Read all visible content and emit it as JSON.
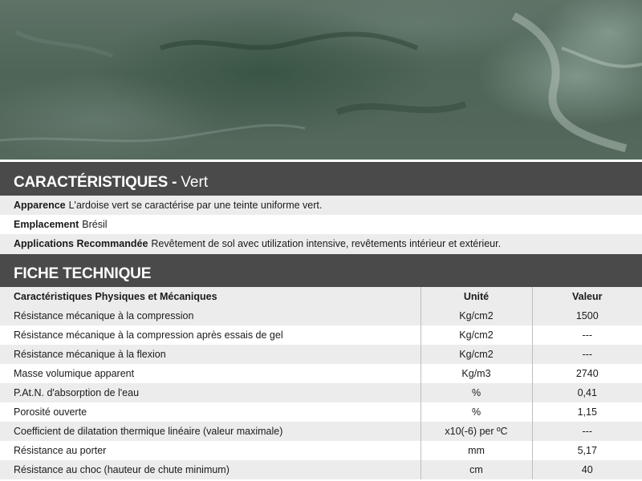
{
  "caracteristiques": {
    "title_strong": "CARACTÉRISTIQUES -",
    "title_light": "Vert",
    "rows": [
      {
        "label": "Apparence",
        "value": "L'ardoise vert se caractérise par une teinte uniforme vert."
      },
      {
        "label": "Emplacement",
        "value": "Brésil"
      },
      {
        "label": "Applications Recommandée",
        "value": "Revêtement de sol avec utilization intensive, revêtements intérieur et extérieur."
      }
    ]
  },
  "fiche": {
    "title": "FICHE TECHNIQUE",
    "headers": [
      "Caractéristiques Physiques et Mécaniques",
      "Unité",
      "Valeur"
    ],
    "rows": [
      [
        "Résistance mécanique à la compression",
        "Kg/cm2",
        "1500"
      ],
      [
        "Résistance mécanique à la compression après essais de gel",
        "Kg/cm2",
        "---"
      ],
      [
        "Résistance mécanique à la flexion",
        "Kg/cm2",
        "---"
      ],
      [
        "Masse volumique apparent",
        "Kg/m3",
        "2740"
      ],
      [
        "P.At.N. d'absorption de l'eau",
        "%",
        "0,41"
      ],
      [
        "Porosité ouverte",
        "%",
        "1,15"
      ],
      [
        "Coefficient de dilatation thermique linéaire (valeur maximale)",
        "x10(-6) per ºC",
        "---"
      ],
      [
        "Résistance au porter",
        "mm",
        "5,17"
      ],
      [
        "Résistance au choc (hauteur de chute minimum)",
        "cm",
        "40"
      ]
    ]
  }
}
